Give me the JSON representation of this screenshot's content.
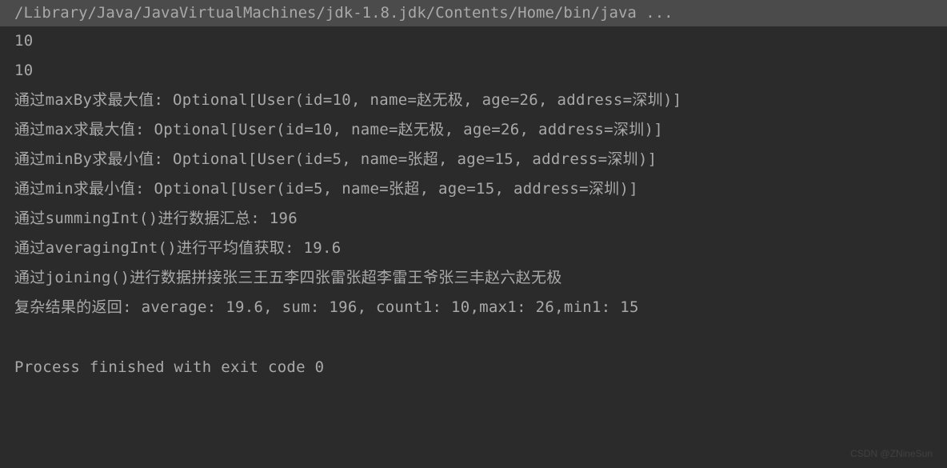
{
  "console": {
    "command": "/Library/Java/JavaVirtualMachines/jdk-1.8.jdk/Contents/Home/bin/java ...",
    "lines": [
      "10",
      "10",
      "通过maxBy求最大值: Optional[User(id=10, name=赵无极, age=26, address=深圳)]",
      "通过max求最大值: Optional[User(id=10, name=赵无极, age=26, address=深圳)]",
      "通过minBy求最小值: Optional[User(id=5, name=张超, age=15, address=深圳)]",
      "通过min求最小值: Optional[User(id=5, name=张超, age=15, address=深圳)]",
      "通过summingInt()进行数据汇总: 196",
      "通过averagingInt()进行平均值获取: 19.6",
      "通过joining()进行数据拼接张三王五李四张雷张超李雷王爷张三丰赵六赵无极",
      "复杂结果的返回: average: 19.6, sum: 196, count1: 10,max1: 26,min1: 15"
    ],
    "exit_message": "Process finished with exit code 0"
  },
  "watermark": "CSDN @ZNineSun"
}
